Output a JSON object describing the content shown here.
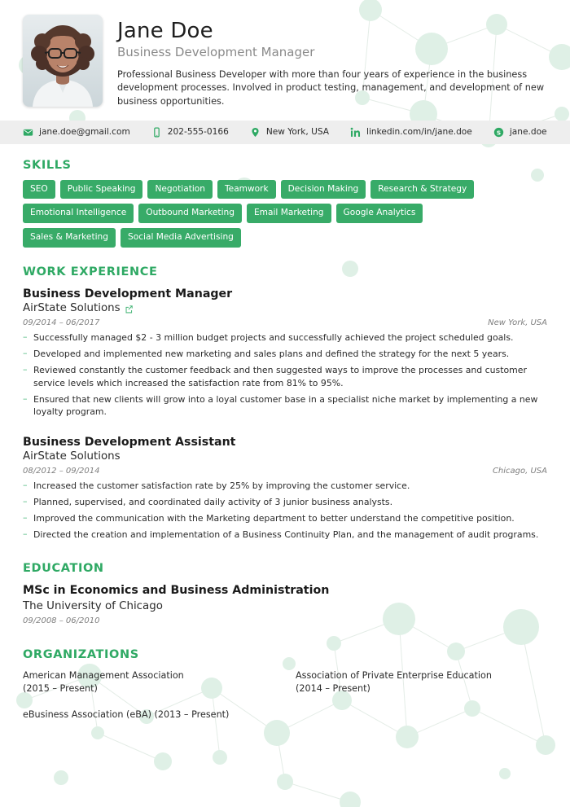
{
  "theme": {
    "accent_green": "#2fa964",
    "tag_green": "#38ab68",
    "contact_bar_bg": "#eeeeee",
    "muted_text": "#8a8a8a"
  },
  "header": {
    "name": "Jane Doe",
    "job_title": "Business Development Manager",
    "summary": "Professional Business Developer with more than four years of experience in the business development processes. Involved in product testing, management, and development of new business opportunities.",
    "photo_alt": "profile-photo"
  },
  "contact": [
    {
      "icon": "email-icon",
      "value": "jane.doe@gmail.com"
    },
    {
      "icon": "phone-icon",
      "value": "202-555-0166"
    },
    {
      "icon": "location-pin-icon",
      "value": "New York, USA"
    },
    {
      "icon": "linkedin-icon",
      "value": "linkedin.com/in/jane.doe"
    },
    {
      "icon": "skype-icon",
      "value": "jane.doe"
    }
  ],
  "skills": {
    "title": "SKILLS",
    "items": [
      "SEO",
      "Public Speaking",
      "Negotiation",
      "Teamwork",
      "Decision Making",
      "Research & Strategy",
      "Emotional Intelligence",
      "Outbound Marketing",
      "Email Marketing",
      "Google Analytics",
      "Sales & Marketing",
      "Social Media Advertising"
    ]
  },
  "work_experience": {
    "title": "WORK EXPERIENCE",
    "jobs": [
      {
        "role": "Business Development Manager",
        "company": "AirState Solutions",
        "has_link": true,
        "dates": "09/2014 – 06/2017",
        "location": "New York, USA",
        "bullets": [
          "Successfully managed $2 - 3 million budget projects and successfully achieved the project scheduled goals.",
          "Developed and implemented new marketing and sales plans and defined the strategy for the next 5 years.",
          "Reviewed constantly the customer feedback and then suggested ways to improve the processes and customer service levels which increased the satisfaction rate from 81% to 95%.",
          "Ensured that new clients will grow into a loyal customer base in a specialist niche market by implementing a new loyalty program."
        ]
      },
      {
        "role": "Business Development Assistant",
        "company": "AirState Solutions",
        "has_link": false,
        "dates": "08/2012 – 09/2014",
        "location": "Chicago, USA",
        "bullets": [
          "Increased the customer satisfaction rate by 25% by improving the customer service.",
          "Planned, supervised, and coordinated daily activity of 3 junior business analysts.",
          "Improved the communication with the Marketing department to better understand the competitive position.",
          "Directed the creation and implementation of a Business Continuity Plan, and the management of audit programs."
        ]
      }
    ]
  },
  "education": {
    "title": "EDUCATION",
    "entries": [
      {
        "degree": "MSc in Economics and Business Administration",
        "school": "The University of Chicago",
        "dates": "09/2008 – 06/2010"
      }
    ]
  },
  "organizations": {
    "title": "ORGANIZATIONS",
    "items": [
      "American Management Association\n(2015 – Present)",
      "Association of Private Enterprise Education\n(2014 – Present)",
      "eBusiness Association (eBA) (2013 – Present)"
    ]
  }
}
